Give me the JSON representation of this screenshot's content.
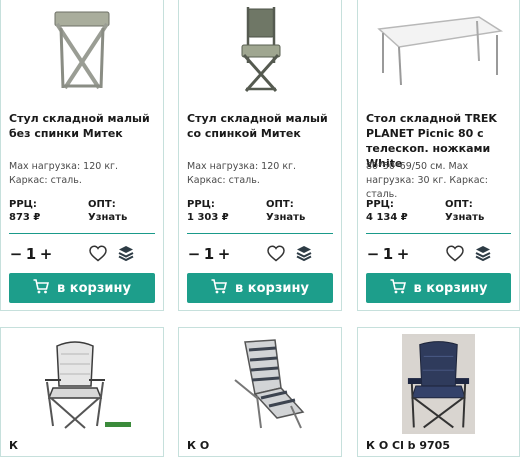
{
  "products": [
    {
      "title": "Стул складной малый без спинки Митек",
      "desc": "Мах нагрузка: 120 кг. Каркас: сталь.",
      "rrp_label": "РРЦ:",
      "rrp_value": "873 ₽",
      "opt_label": "ОПТ:",
      "opt_value": "Узнать",
      "image": "folding-stool-no-back"
    },
    {
      "title": "Стул складной малый со спинкой Митек",
      "desc": "Мах нагрузка: 120 кг. Каркас: сталь.",
      "rrp_label": "РРЦ:",
      "rrp_value": "1 303 ₽",
      "opt_label": "ОПТ:",
      "opt_value": "Узнать",
      "image": "folding-stool-with-back"
    },
    {
      "title": "Стол складной TREK PLANET Picnic 80 с телескоп. ножками White",
      "desc": "80*50*69/50 см. Мах нагрузка: 30 кг. Каркас: сталь.",
      "rrp_label": "РРЦ:",
      "rrp_value": "4 134 ₽",
      "opt_label": "ОПТ:",
      "opt_value": "Узнать",
      "image": "folding-table-white"
    }
  ],
  "bottom_products": [
    {
      "title": "К",
      "image": "camping-armchair-grey"
    },
    {
      "title": "К                О",
      "image": "striped-lounger"
    },
    {
      "title": "К       О      Cl  b  9705",
      "image": "padded-armchair-blue"
    }
  ],
  "common": {
    "qty_minus": "−",
    "qty_value": "1",
    "qty_plus": "+",
    "cart_label": "в корзину"
  },
  "colors": {
    "accent": "#1d9e8b",
    "border": "#c6e0dc"
  },
  "icons": [
    "heart-icon",
    "layers-icon",
    "cart-icon"
  ]
}
